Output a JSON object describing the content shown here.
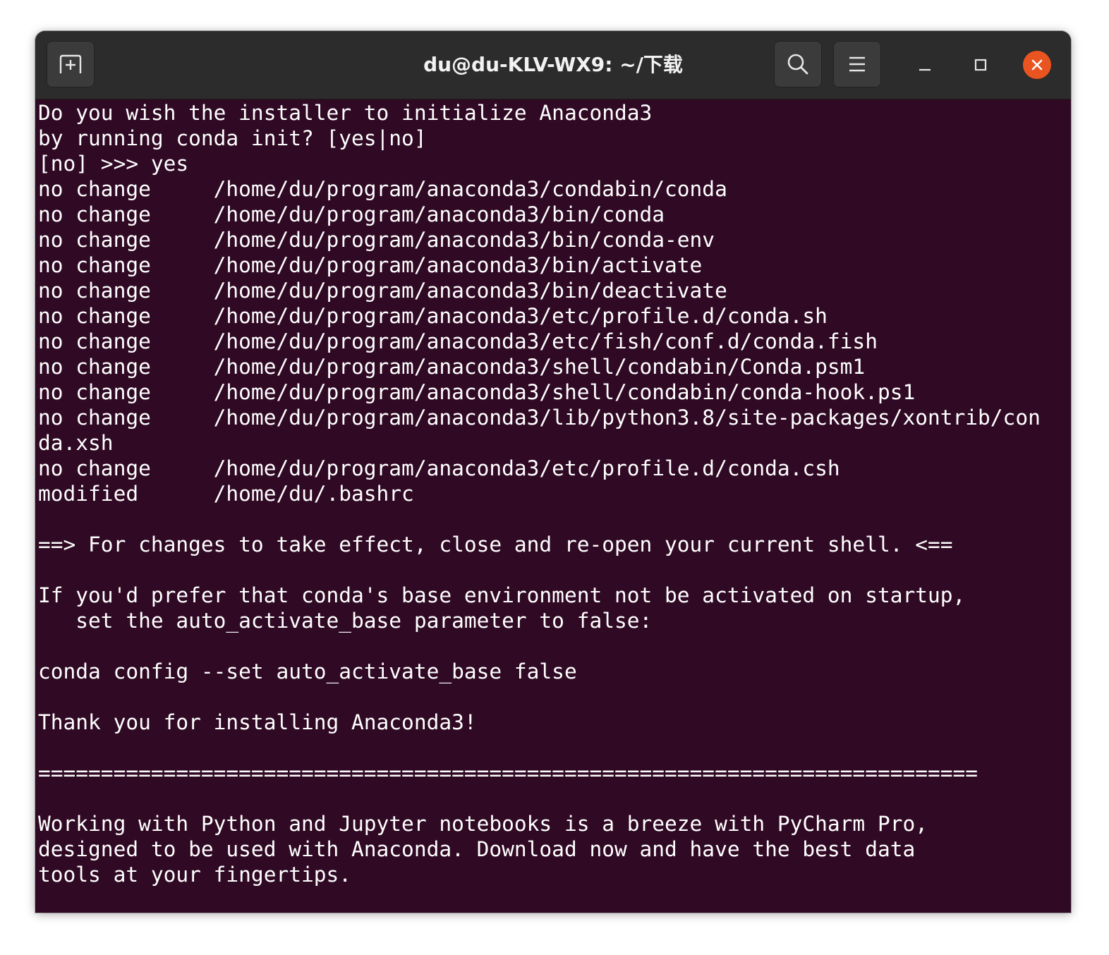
{
  "window": {
    "title": "du@du-KLV-WX9: ~/下载"
  },
  "icons": {
    "new_tab": "new-tab-icon",
    "search": "search-icon",
    "menu": "hamburger-menu-icon",
    "minimize": "minimize-icon",
    "maximize": "maximize-icon",
    "close": "close-icon"
  },
  "colors": {
    "terminal_bg": "#300a24",
    "titlebar_bg": "#2c2c2c",
    "close_accent": "#e95420",
    "text": "#ffffff"
  },
  "terminal": {
    "lines": [
      "Do you wish the installer to initialize Anaconda3",
      "by running conda init? [yes|no]",
      "[no] >>> yes",
      "no change     /home/du/program/anaconda3/condabin/conda",
      "no change     /home/du/program/anaconda3/bin/conda",
      "no change     /home/du/program/anaconda3/bin/conda-env",
      "no change     /home/du/program/anaconda3/bin/activate",
      "no change     /home/du/program/anaconda3/bin/deactivate",
      "no change     /home/du/program/anaconda3/etc/profile.d/conda.sh",
      "no change     /home/du/program/anaconda3/etc/fish/conf.d/conda.fish",
      "no change     /home/du/program/anaconda3/shell/condabin/Conda.psm1",
      "no change     /home/du/program/anaconda3/shell/condabin/conda-hook.ps1",
      "no change     /home/du/program/anaconda3/lib/python3.8/site-packages/xontrib/con",
      "da.xsh",
      "no change     /home/du/program/anaconda3/etc/profile.d/conda.csh",
      "modified      /home/du/.bashrc",
      "",
      "==> For changes to take effect, close and re-open your current shell. <==",
      "",
      "If you'd prefer that conda's base environment not be activated on startup,",
      "   set the auto_activate_base parameter to false:",
      "",
      "conda config --set auto_activate_base false",
      "",
      "Thank you for installing Anaconda3!",
      "",
      "===========================================================================",
      "",
      "Working with Python and Jupyter notebooks is a breeze with PyCharm Pro,",
      "designed to be used with Anaconda. Download now and have the best data",
      "tools at your fingertips."
    ]
  }
}
